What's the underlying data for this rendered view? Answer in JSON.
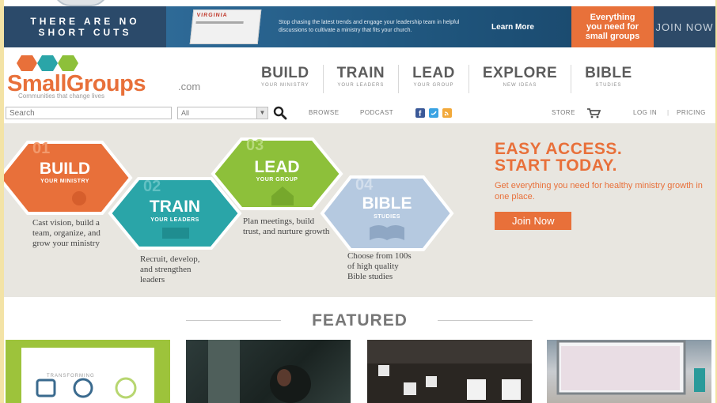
{
  "banner": {
    "headline_line1": "THERE ARE NO",
    "headline_line2": "SHORT CUTS",
    "book_title": "VIRGINIA",
    "promo_text": "Stop chasing the latest trends and engage your leadership team in helpful discussions to cultivate a ministry that fits your church.",
    "learn_more": "Learn More",
    "everything_line1": "Everything",
    "everything_line2": "you need for",
    "everything_line3": "small groups",
    "join_now": "JOIN NOW"
  },
  "header": {
    "logo_word": "SmallGroups",
    "logo_com": ".com",
    "tagline": "Communities that change lives",
    "nav": [
      {
        "title": "BUILD",
        "sub": "YOUR MINISTRY"
      },
      {
        "title": "TRAIN",
        "sub": "YOUR LEADERS"
      },
      {
        "title": "LEAD",
        "sub": "YOUR GROUP"
      },
      {
        "title": "EXPLORE",
        "sub": "NEW IDEAS"
      },
      {
        "title": "BIBLE",
        "sub": "STUDIES"
      }
    ]
  },
  "utility": {
    "search_placeholder": "Search",
    "select_value": "All",
    "browse": "BROWSE",
    "podcast": "PODCAST",
    "store": "STORE",
    "login": "LOG IN",
    "pricing": "PRICING"
  },
  "hero": {
    "hexes": [
      {
        "number": "01",
        "title": "BUILD",
        "sub": "YOUR MINISTRY",
        "desc": "Cast vision, build a team, organize, and grow your ministry"
      },
      {
        "number": "02",
        "title": "TRAIN",
        "sub": "YOUR LEADERS",
        "desc": "Recruit, develop, and strengthen leaders"
      },
      {
        "number": "03",
        "title": "LEAD",
        "sub": "YOUR GROUP",
        "desc": "Plan meetings, build trust, and nurture growth"
      },
      {
        "number": "04",
        "title": "BIBLE",
        "sub": "STUDIES",
        "desc": "Choose from 100s of high quality Bible studies"
      }
    ],
    "cta_line1": "EASY ACCESS.",
    "cta_line2": "START TODAY.",
    "cta_sub": "Get everything you need for healthy ministry growth in one place.",
    "cta_button": "Join Now"
  },
  "featured": {
    "title": "FEATURED",
    "card1_text": "TRANSFORMING"
  },
  "colors": {
    "orange": "#e8703a",
    "teal": "#2aa5a8",
    "green": "#8dc03a",
    "light_blue": "#b5c9e0",
    "banner_blue": "#2a5a84",
    "hero_bg": "#e8e6e0"
  }
}
